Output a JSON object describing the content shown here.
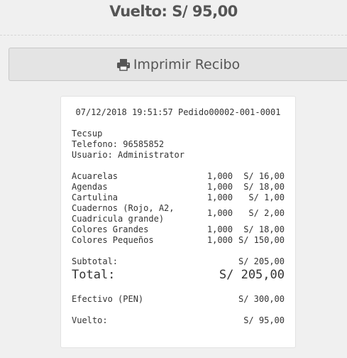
{
  "header": {
    "change_title": "Vuelto: S/ 95,00"
  },
  "print_button": {
    "label": "Imprimir Recibo",
    "icon": "print-icon"
  },
  "receipt": {
    "header_line": "07/12/2018 19:51:57 Pedido00002-001-0001",
    "company": "Tecsup",
    "phone": "Telefono: 96585852",
    "user": "Usuario: Administrator",
    "items": [
      {
        "name": "Acuarelas",
        "qty": "1,000",
        "price": "S/ 16,00"
      },
      {
        "name": "Agendas",
        "qty": "1,000",
        "price": "S/ 18,00"
      },
      {
        "name": "Cartulina",
        "qty": "1,000",
        "price": "S/ 1,00"
      },
      {
        "name": "Cuadernos (Rojo, A2,",
        "name2": "Cuadricula grande)",
        "qty": "1,000",
        "price": "S/ 2,00"
      },
      {
        "name": "Colores Grandes",
        "qty": "1,000",
        "price": "S/ 18,00"
      },
      {
        "name": "Colores Pequeños",
        "qty": "1,000",
        "price": "S/ 150,00"
      }
    ],
    "subtotal_label": "Subtotal:",
    "subtotal_value": "S/ 205,00",
    "total_label": "Total:",
    "total_value": "S/ 205,00",
    "payment_label": "Efectivo (PEN)",
    "payment_value": "S/ 300,00",
    "change_label": "Vuelto:",
    "change_value": "S/ 95,00"
  }
}
